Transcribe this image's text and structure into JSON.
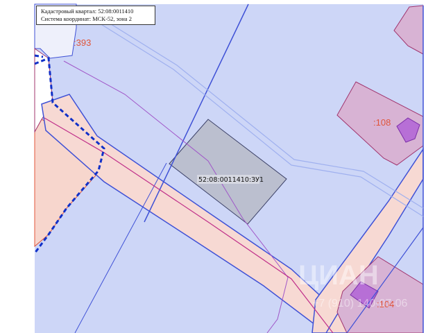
{
  "legend": {
    "quarter_line": "Кадастровый квартал: 52:08:0011410",
    "crs_line": "Система координат: МСК-52, зона 2"
  },
  "labels": {
    "plot_393": ":393",
    "plot_108": ":108",
    "plot_104": ":104",
    "target_plot": "52:08:0011410:ЗУ1"
  },
  "watermark": {
    "text": "ЦИАН",
    "phone": "+7 (910) 140-07-06"
  },
  "colors": {
    "quarter_fill": "#cdd6f7",
    "road_fill": "#f7d9d3",
    "building_fill": "#d6a6c7",
    "structure_fill": "#b76fd6",
    "target_fill": "#b9bcca",
    "quarter_border": "#3f51d6",
    "parcel_border": "#a0346e",
    "boundary_dash": "#1030c8",
    "label_color": "#e0553a"
  }
}
